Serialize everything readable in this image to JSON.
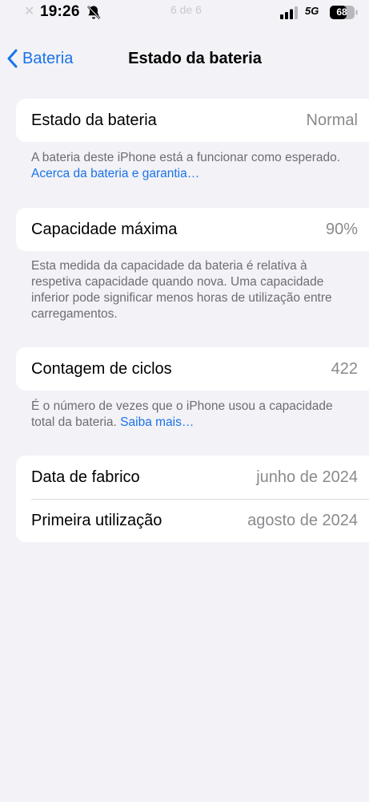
{
  "status_bar": {
    "time": "19:26",
    "network": "5G",
    "battery_level": "68",
    "icons": [
      "bell-slash-icon",
      "cellular-signal-icon",
      "battery-icon"
    ]
  },
  "overlay": {
    "close_glyph": "✕",
    "counter": "6 de 6"
  },
  "nav": {
    "back_label": "Bateria",
    "title": "Estado da bateria"
  },
  "health": {
    "label": "Estado da bateria",
    "value": "Normal",
    "footer_text": "A bateria deste iPhone está a funcionar como esperado.",
    "footer_link": "Acerca da bateria e garantia…"
  },
  "capacity": {
    "label": "Capacidade máxima",
    "value": "90%",
    "footer_text": "Esta medida da capacidade da bateria é relativa à respetiva capacidade quando nova. Uma capacidade inferior pode significar menos horas de utilização entre carregamentos."
  },
  "cycles": {
    "label": "Contagem de ciclos",
    "value": "422",
    "footer_text": "É o número de vezes que o iPhone usou a capacidade total da bateria.",
    "footer_link": "Saiba mais…"
  },
  "dates": {
    "manufacture_label": "Data de fabrico",
    "manufacture_value": "junho de 2024",
    "first_use_label": "Primeira utilização",
    "first_use_value": "agosto de 2024"
  },
  "colors": {
    "background": "#f2f2f7",
    "accent": "#1a73e8",
    "secondary_text": "#8a8a8e"
  }
}
